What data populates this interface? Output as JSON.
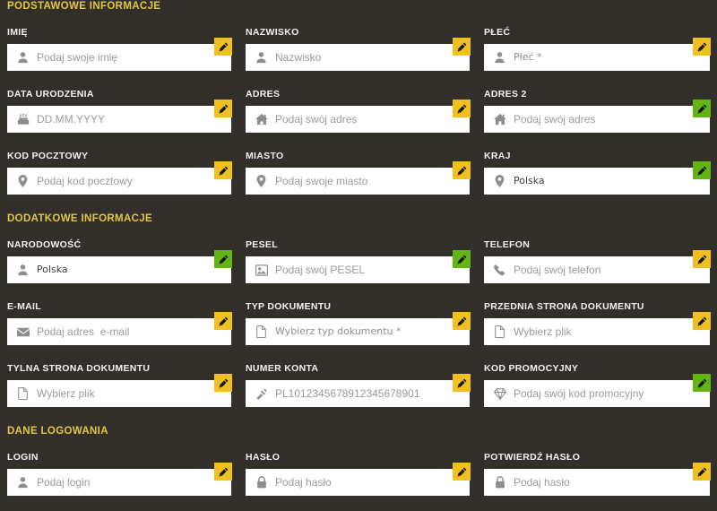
{
  "theme": {
    "background": "#322f2b",
    "section_title_color": "#e5c545",
    "label_color": "#f2f2f2",
    "input_background": "#ffffff",
    "placeholder_color": "#9a9a9a",
    "badge_edit_color": "#efc01f",
    "badge_valid_color": "#63b514"
  },
  "sections": [
    {
      "title": "PODSTAWOWE INFORMACJE",
      "rows": [
        [
          {
            "label": "IMIĘ",
            "placeholder": "Podaj swoje imię",
            "icon": "person-icon",
            "badge": "edit-pencil-icon",
            "badge_color": "yellow",
            "filled": false,
            "type": "text"
          },
          {
            "label": "NAZWISKO",
            "placeholder": "Nazwisko",
            "icon": "person-icon",
            "badge": "edit-pencil-icon",
            "badge_color": "yellow",
            "filled": false,
            "type": "text"
          },
          {
            "label": "PŁEĆ",
            "placeholder": "Płeć *",
            "icon": "person-icon",
            "badge": "edit-pencil-icon",
            "badge_color": "yellow",
            "filled": false,
            "type": "select"
          }
        ],
        [
          {
            "label": "DATA URODZENIA",
            "placeholder": "DD.MM.YYYY",
            "icon": "birthday-cake-icon",
            "badge": "edit-pencil-icon",
            "badge_color": "yellow",
            "filled": false,
            "type": "text"
          },
          {
            "label": "ADRES",
            "placeholder": "Podaj swój adres",
            "icon": "home-icon",
            "badge": "edit-pencil-icon",
            "badge_color": "yellow",
            "filled": false,
            "type": "text"
          },
          {
            "label": "ADRES 2",
            "placeholder": "Podaj swój adres",
            "icon": "home-icon",
            "badge": "edit-pencil-icon",
            "badge_color": "green",
            "filled": false,
            "type": "text"
          }
        ],
        [
          {
            "label": "KOD POCZTOWY",
            "placeholder": "Podaj kod pocztowy",
            "icon": "map-pin-icon",
            "badge": "edit-pencil-icon",
            "badge_color": "yellow",
            "filled": false,
            "type": "text"
          },
          {
            "label": "MIASTO",
            "placeholder": "Podaj swoje miasto",
            "icon": "map-pin-icon",
            "badge": "edit-pencil-icon",
            "badge_color": "yellow",
            "filled": false,
            "type": "text"
          },
          {
            "label": "KRAJ",
            "placeholder": "Polska",
            "icon": "map-pin-icon",
            "badge": "edit-pencil-icon",
            "badge_color": "green",
            "filled": true,
            "type": "select"
          }
        ]
      ]
    },
    {
      "title": "DODATKOWE INFORMACJE",
      "rows": [
        [
          {
            "label": "NARODOWOŚĆ",
            "placeholder": "Polska",
            "icon": "person-icon",
            "badge": "edit-pencil-icon",
            "badge_color": "green",
            "filled": true,
            "type": "select"
          },
          {
            "label": "PESEL",
            "placeholder": "Podaj swój PESEL",
            "icon": "id-card-icon",
            "badge": "edit-pencil-icon",
            "badge_color": "green",
            "filled": false,
            "type": "text"
          },
          {
            "label": "TELEFON",
            "placeholder": "Podaj swój telefon",
            "icon": "phone-icon",
            "badge": "edit-pencil-icon",
            "badge_color": "yellow",
            "filled": false,
            "type": "text"
          }
        ],
        [
          {
            "label": "E-MAIL",
            "placeholder": "Podaj adres  e-mail",
            "icon": "envelope-icon",
            "badge": "edit-pencil-icon",
            "badge_color": "yellow",
            "filled": false,
            "type": "text"
          },
          {
            "label": "TYP DOKUMENTU",
            "placeholder": "Wybierz typ dokumentu *",
            "icon": "file-icon",
            "badge": "edit-pencil-icon",
            "badge_color": "yellow",
            "filled": false,
            "type": "select"
          },
          {
            "label": "PRZEDNIA STRONA DOKUMENTU",
            "placeholder": "Wybierz plik",
            "icon": "file-icon",
            "badge": "edit-pencil-icon",
            "badge_color": "yellow",
            "filled": false,
            "type": "file"
          }
        ],
        [
          {
            "label": "TYLNA STRONA DOKUMENTU",
            "placeholder": "Wybierz plik",
            "icon": "file-icon",
            "badge": "edit-pencil-icon",
            "badge_color": "yellow",
            "filled": false,
            "type": "file"
          },
          {
            "label": "NUMER KONTA",
            "placeholder": "PL1012345678912345678901",
            "icon": "bank-icon",
            "badge": "edit-pencil-icon",
            "badge_color": "yellow",
            "filled": false,
            "type": "text"
          },
          {
            "label": "KOD PROMOCYJNY",
            "placeholder": "Podaj swój kod promocyjny",
            "icon": "gem-icon",
            "badge": "edit-pencil-icon",
            "badge_color": "green",
            "filled": false,
            "type": "text"
          }
        ]
      ]
    },
    {
      "title": "DANE LOGOWANIA",
      "rows": [
        [
          {
            "label": "LOGIN",
            "placeholder": "Podaj login",
            "icon": "person-icon",
            "badge": "edit-pencil-icon",
            "badge_color": "yellow",
            "filled": false,
            "type": "text"
          },
          {
            "label": "HASŁO",
            "placeholder": "Podaj hasło",
            "icon": "lock-icon",
            "badge": "edit-pencil-icon",
            "badge_color": "yellow",
            "filled": false,
            "type": "password"
          },
          {
            "label": "POTWIERDŹ HASŁO",
            "placeholder": "Podaj hasło",
            "icon": "lock-icon",
            "badge": "edit-pencil-icon",
            "badge_color": "yellow",
            "filled": false,
            "type": "password"
          }
        ]
      ]
    }
  ]
}
